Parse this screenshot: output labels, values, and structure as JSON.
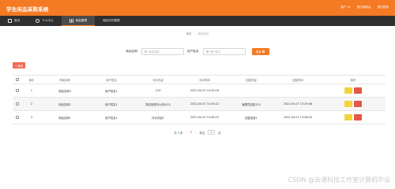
{
  "app": {
    "title": "学生闲品采购系统",
    "user_label": "用户 ▾1",
    "link_front": "退出到前台",
    "link_logout": "退出登录"
  },
  "nav": {
    "items": [
      {
        "label": "首页",
        "icon": "home-icon"
      },
      {
        "label": "个人中心",
        "icon": "user-icon"
      },
      {
        "label": "商品管理",
        "icon": "grid-icon"
      },
      {
        "label": "商品评价管理",
        "icon": ""
      }
    ],
    "active_index": 2
  },
  "breadcrumb": {
    "home": "首页",
    "separator": "/",
    "current": "商品评价"
  },
  "search": {
    "field1_label": "商品名称:",
    "field1_placeholder": "商品名称",
    "field2_label": "用户姓名:",
    "field2_placeholder": "用户姓名",
    "button_label": "查询"
  },
  "toolbar": {
    "add_label": "+ 新增"
  },
  "table": {
    "headers": [
      "索引",
      "商品名称",
      "用户姓名",
      "评价内容",
      "评价时间",
      "回复内容",
      "回复时间",
      "操作"
    ],
    "rows": [
      {
        "idx": "1",
        "name": "商品名称3",
        "user": "用户姓名1",
        "eval": "123",
        "etime": "2022-04-07 14:30:16",
        "reply": "",
        "rtime": ""
      },
      {
        "idx": "2",
        "name": "商品名称1",
        "user": "用户姓名1",
        "eval": "购买就是可以评价23",
        "etime": "2022-04-07 14:29:22",
        "reply": "管理员回复123",
        "rtime": "2022-04-07 15:29:48"
      },
      {
        "idx": "3",
        "name": "商品名称1",
        "user": "用户姓名1",
        "eval": "评价内容1",
        "etime": "2022-04-07 13:46:23",
        "reply": "回复信息1",
        "rtime": "2022-04-07 13:46:23"
      }
    ]
  },
  "pager": {
    "total": "共 3 条",
    "prev": "‹",
    "current_page": "1",
    "next": "›",
    "goto_label": "前往",
    "goto_value": "1",
    "page_unit": "页"
  },
  "watermark": "CSDN @云谱科技工作室计算机毕设",
  "colors": {
    "accent": "#f47a24",
    "nav_bg": "#2f2f2f",
    "edit": "#f2d43a",
    "delete": "#e2584a",
    "add": "#f16b54"
  }
}
